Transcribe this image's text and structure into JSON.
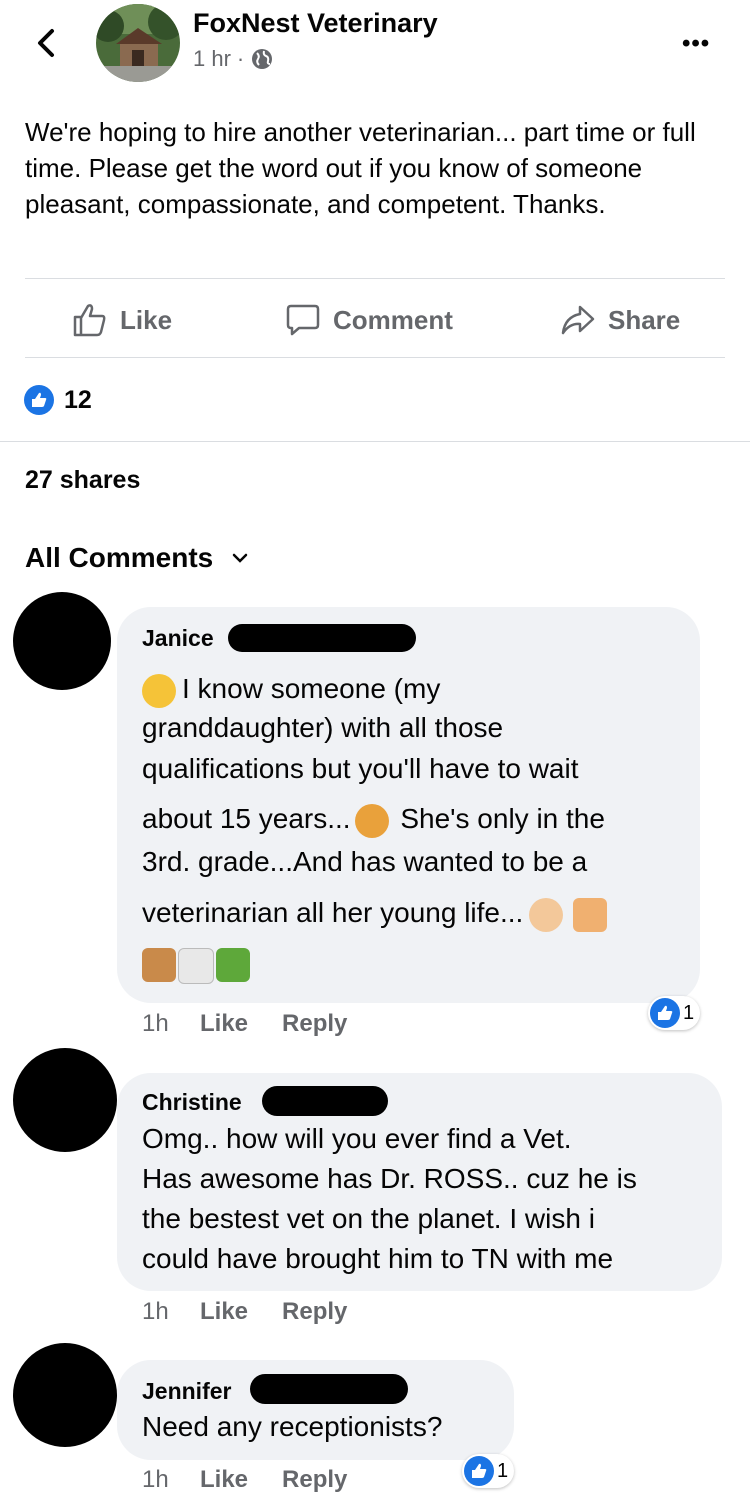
{
  "header": {
    "page_name": "FoxNest Veterinary",
    "time": "1 hr",
    "dot": "·",
    "more_label": "•••"
  },
  "post": {
    "text": "We're hoping to hire another veterinarian... part time or full time. Please get the word out if you know of someone pleasant, compassionate, and competent. Thanks."
  },
  "actions": {
    "like": "Like",
    "comment": "Comment",
    "share": "Share"
  },
  "stats": {
    "reactions": "12",
    "shares": "27 shares"
  },
  "comments_header": "All Comments",
  "comments": [
    {
      "name": "Janice",
      "lines": [
        "I know someone (my",
        "granddaughter) with all those",
        "qualifications but you'll have to wait",
        "about 15 years...",
        " She's only in the",
        "3rd. grade...And has wanted to be a",
        "veterinarian all her young life..."
      ],
      "time": "1h",
      "like": "Like",
      "reply": "Reply",
      "reactions": "1"
    },
    {
      "name": "Christine",
      "lines": [
        "Omg.. how will you ever find a Vet.",
        "Has awesome has Dr. ROSS.. cuz he is",
        "the bestest vet on the planet. I wish i",
        "could have brought him to TN with me"
      ],
      "time": "1h",
      "like": "Like",
      "reply": "Reply"
    },
    {
      "name": "Jennifer",
      "lines": [
        "Need any receptionists?"
      ],
      "time": "1h",
      "like": "Like",
      "reply": "Reply",
      "reactions": "1"
    }
  ],
  "colors": {
    "accent": "#1b74e4",
    "bubble": "#f0f2f5",
    "secondary_text": "#65676b",
    "divider": "#dadde1"
  },
  "icons": [
    "back-chevron-icon",
    "globe-icon",
    "more-icon",
    "thumbs-up-icon",
    "comment-icon",
    "share-arrow-icon",
    "chevron-down-icon",
    "like-badge-icon",
    "hug-emoji-icon",
    "laughing-cat-emoji-icon",
    "girl-emoji-icon",
    "cat-emoji-icon",
    "dog-emoji-icon",
    "rabbit-emoji-icon",
    "turtle-emoji-icon"
  ]
}
